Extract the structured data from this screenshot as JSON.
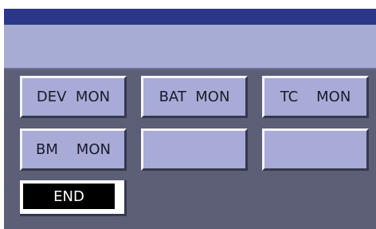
{
  "buttons": {
    "dev_mon": "DEV  MON",
    "bat_mon": "BAT  MON",
    "tc_mon": "TC    MON",
    "bm_mon": "BM    MON",
    "empty_1": "",
    "empty_2": ""
  },
  "end_button": {
    "label": "END"
  },
  "colors": {
    "title_bar": "#2c3789",
    "header_bar": "#a7acd4",
    "button_face": "#a7abd6",
    "panel_background": "#7e829c"
  }
}
